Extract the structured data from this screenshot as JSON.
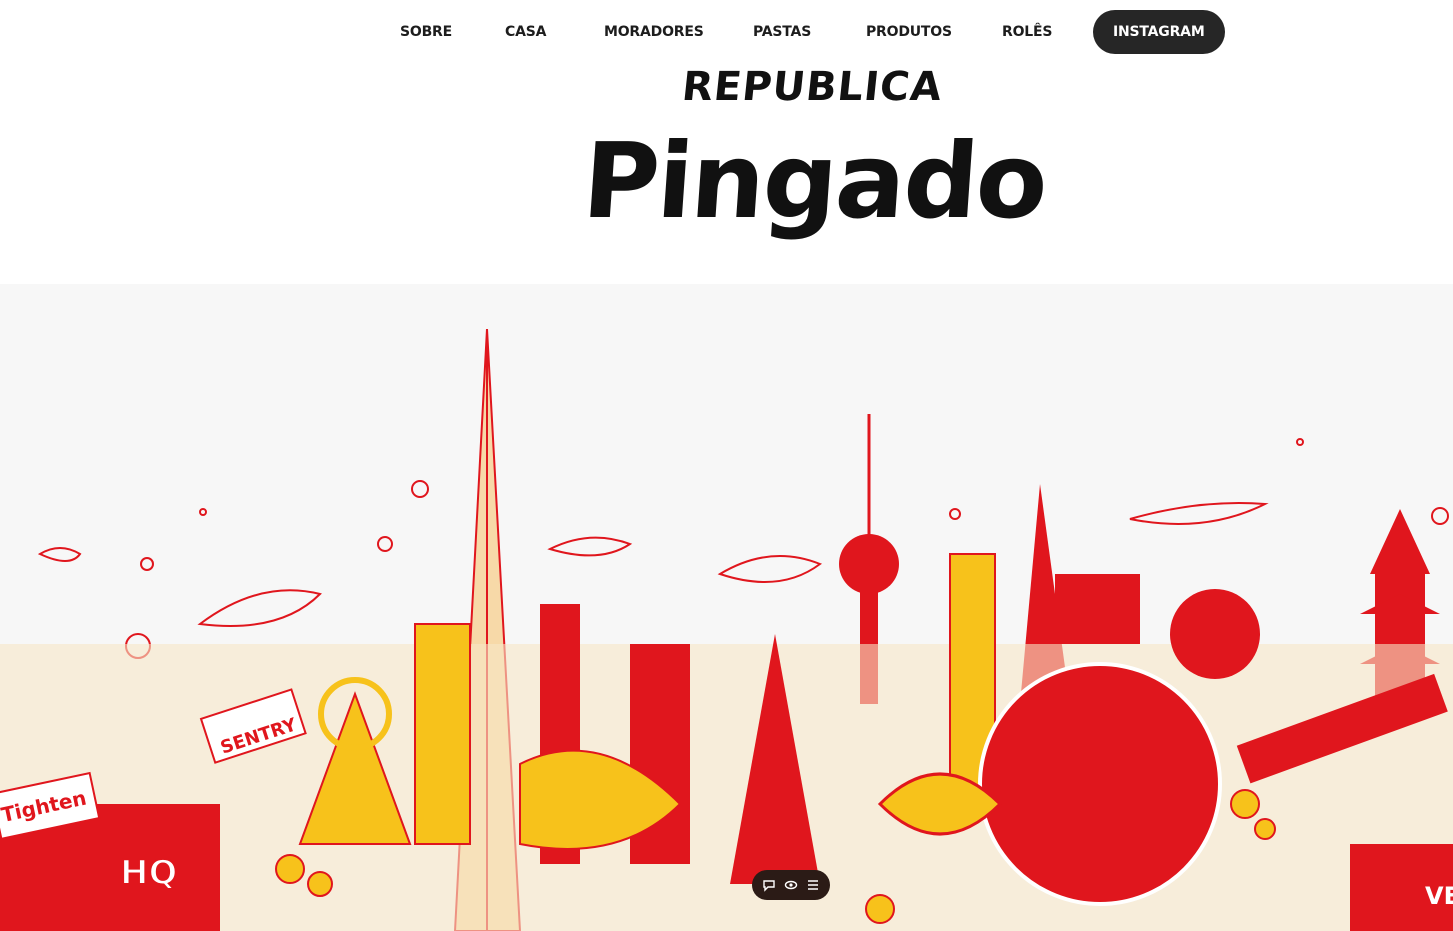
{
  "nav": {
    "items": [
      {
        "label": "SOBRE"
      },
      {
        "label": "CASA"
      },
      {
        "label": "MORADORES"
      },
      {
        "label": "PASTAS"
      },
      {
        "label": "PRODUTOS"
      },
      {
        "label": "ROLÊS"
      }
    ],
    "cta_label": "INSTAGRAM"
  },
  "brand": {
    "line1": "REPUBLICA",
    "line2": "Pingado"
  },
  "hero": {
    "illustration_signs": [
      "SENTRY",
      "Tighten",
      "HQ",
      "VE"
    ]
  },
  "toolbar": {
    "icons": [
      "chat-icon",
      "eye-icon",
      "menu-icon"
    ]
  },
  "colors": {
    "accent_red": "#e0161d",
    "accent_yellow": "#f7c21b",
    "cream": "#f7e6c6",
    "ink": "#1d1d1d",
    "cta_bg": "#262626"
  }
}
